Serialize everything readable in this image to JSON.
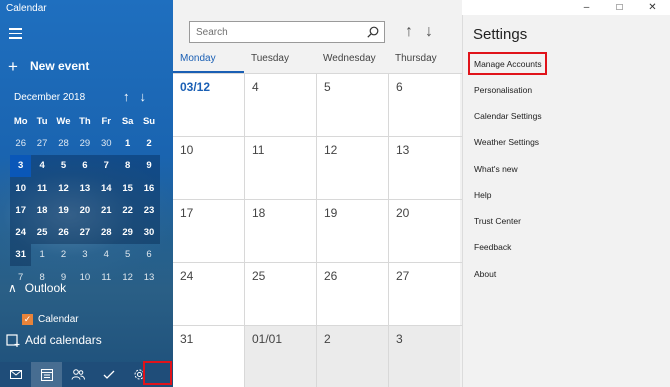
{
  "app": {
    "title": "Calendar"
  },
  "sidebar": {
    "new_event_label": "New event",
    "mini_calendar": {
      "month_label": "December 2018",
      "weekdays": [
        "Mo",
        "Tu",
        "We",
        "Th",
        "Fr",
        "Sa",
        "Su"
      ],
      "weeks": [
        [
          "26",
          "27",
          "28",
          "29",
          "30",
          "1",
          "2"
        ],
        [
          "3",
          "4",
          "5",
          "6",
          "7",
          "8",
          "9"
        ],
        [
          "10",
          "11",
          "12",
          "13",
          "14",
          "15",
          "16"
        ],
        [
          "17",
          "18",
          "19",
          "20",
          "21",
          "22",
          "23"
        ],
        [
          "24",
          "25",
          "26",
          "27",
          "28",
          "29",
          "30"
        ],
        [
          "31",
          "1",
          "2",
          "3",
          "4",
          "5",
          "6"
        ],
        [
          "7",
          "8",
          "9",
          "10",
          "11",
          "12",
          "13"
        ]
      ]
    },
    "account_group": "Outlook",
    "calendar_item": "Calendar",
    "add_calendars_label": "Add calendars",
    "bottom_nav": [
      "mail-icon",
      "calendar-icon",
      "people-icon",
      "todo-icon",
      "settings-icon"
    ]
  },
  "search": {
    "placeholder": "Search"
  },
  "week_view": {
    "day_headers": [
      "Monday",
      "Tuesday",
      "Wednesday",
      "Thursday"
    ],
    "rows": [
      [
        "03/12",
        "4",
        "5",
        "6"
      ],
      [
        "10",
        "11",
        "12",
        "13"
      ],
      [
        "17",
        "18",
        "19",
        "20"
      ],
      [
        "24",
        "25",
        "26",
        "27"
      ],
      [
        "31",
        "01/01",
        "2",
        "3"
      ]
    ]
  },
  "settings_pane": {
    "title": "Settings",
    "items": [
      "Manage Accounts",
      "Personalisation",
      "Calendar Settings",
      "Weather Settings",
      "What's new",
      "Help",
      "Trust Center",
      "Feedback",
      "About"
    ]
  },
  "colors": {
    "accent": "#1a5fb4",
    "highlight_box": "#e0131a",
    "sidebar_bg": "#1a64b0",
    "checkbox": "#e8833a"
  }
}
